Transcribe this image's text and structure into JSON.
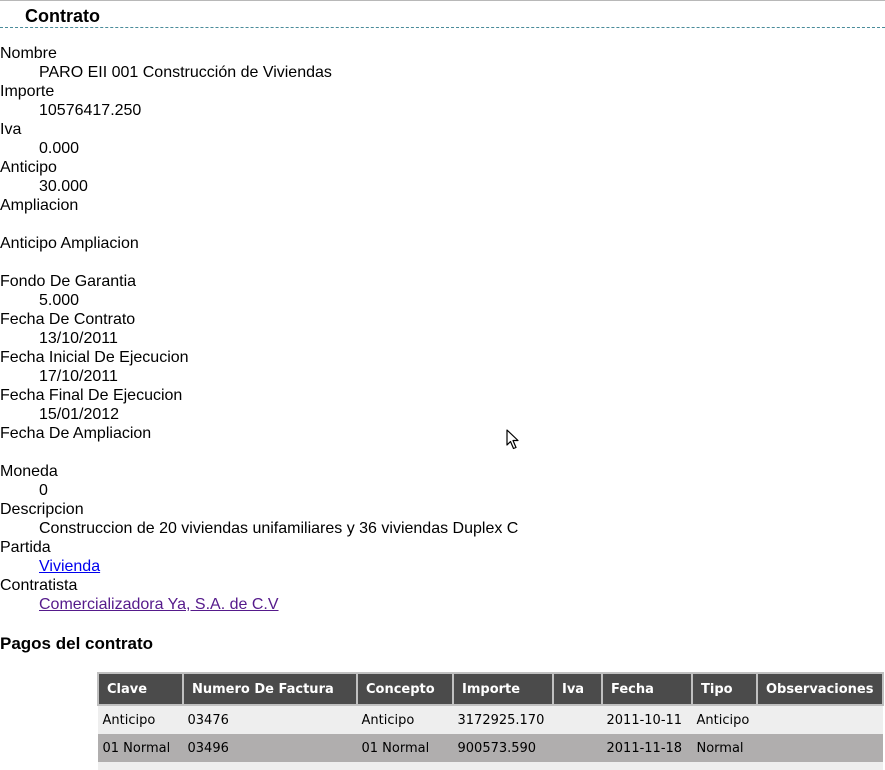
{
  "page": {
    "title": "Contrato"
  },
  "fields": [
    {
      "label": "Nombre",
      "value": "PARO EII 001 Construcción de Viviendas"
    },
    {
      "label": "Importe",
      "value": "10576417.250"
    },
    {
      "label": "Iva",
      "value": "0.000"
    },
    {
      "label": "Anticipo",
      "value": "30.000"
    },
    {
      "label": "Ampliacion",
      "value": ""
    },
    {
      "label": "Anticipo Ampliacion",
      "value": ""
    },
    {
      "label": "Fondo De Garantia",
      "value": "5.000"
    },
    {
      "label": "Fecha De Contrato",
      "value": "13/10/2011"
    },
    {
      "label": "Fecha Inicial De Ejecucion",
      "value": "17/10/2011"
    },
    {
      "label": "Fecha Final De Ejecucion",
      "value": "15/01/2012"
    },
    {
      "label": "Fecha De Ampliacion",
      "value": ""
    },
    {
      "label": "Moneda",
      "value": "0"
    },
    {
      "label": "Descripcion",
      "value": "Construccion de 20 viviendas unifamiliares y 36 viviendas Duplex C"
    },
    {
      "label": "Partida",
      "value": "Vivienda"
    },
    {
      "label": "Contratista",
      "value": "Comercializadora Ya, S.A. de C.V"
    }
  ],
  "payments": {
    "title": "Pagos del contrato",
    "columns": [
      "Clave",
      "Numero De Factura",
      "Concepto",
      "Importe",
      "Iva",
      "Fecha",
      "Tipo",
      "Observaciones"
    ],
    "rows": [
      [
        "Anticipo",
        "03476",
        "Anticipo",
        "3172925.170",
        "",
        "2011-10-11",
        "Anticipo",
        ""
      ],
      [
        "01 Normal",
        "03496",
        "01 Normal",
        "900573.590",
        "",
        "2011-11-18",
        "Normal",
        ""
      ]
    ]
  },
  "colors": {
    "header_bg": "#4b4b4b",
    "row_light": "#eeeeee",
    "row_dark": "#b0aeae",
    "link": "#0000ee",
    "link_visited": "#551a8b",
    "title_rule": "#4a8c9a"
  },
  "icons": {
    "cursor": "mouse-pointer-icon"
  }
}
